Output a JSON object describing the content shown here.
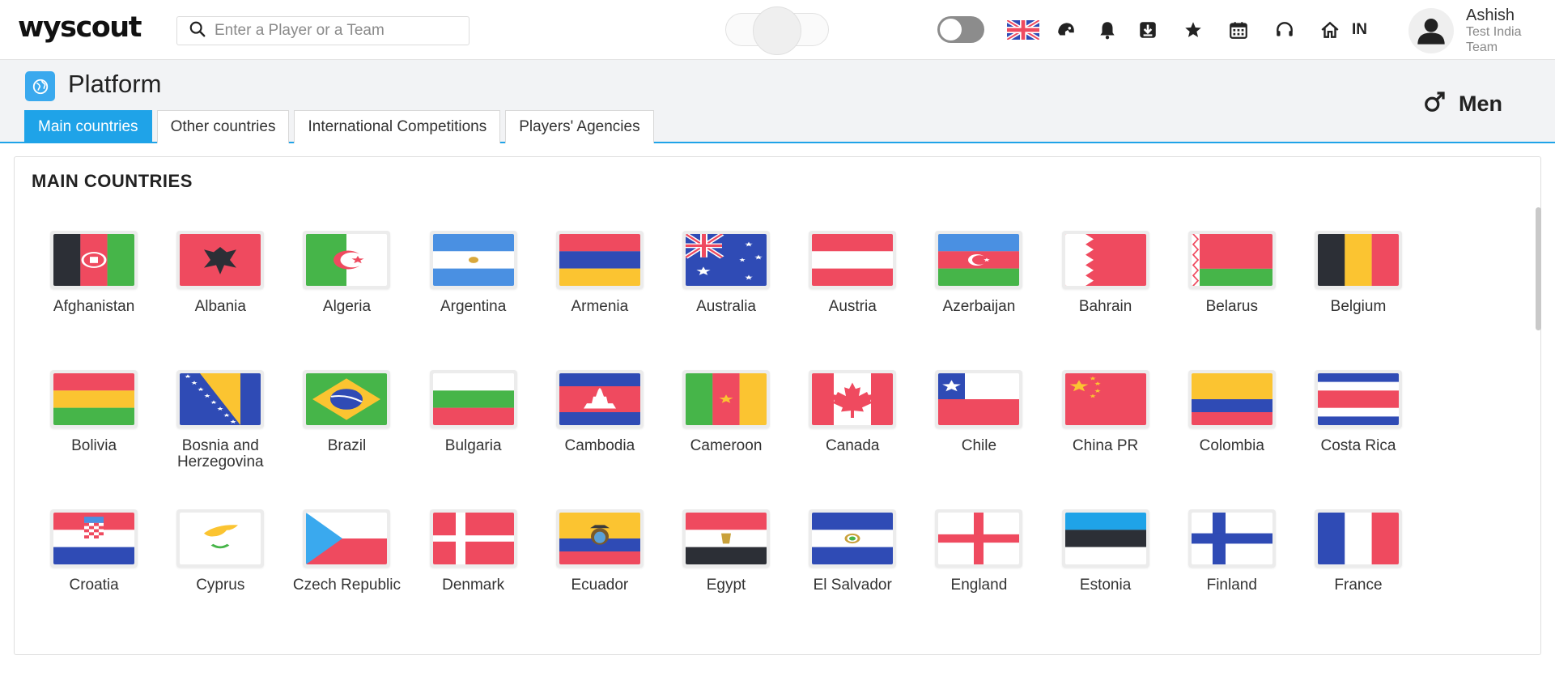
{
  "app": {
    "logo": "wyscout"
  },
  "search": {
    "placeholder": "Enter a Player or a Team"
  },
  "header": {
    "language_code": "IN",
    "user": {
      "name": "Ashish",
      "team": "Test India Team"
    },
    "icons": [
      "uk-flag-icon",
      "helmet-icon",
      "bell-icon",
      "download-icon",
      "star-icon",
      "calendar-icon",
      "headset-icon",
      "home-icon"
    ]
  },
  "page": {
    "title": "Platform",
    "gender": "Men",
    "tabs": [
      {
        "label": "Main countries",
        "active": true
      },
      {
        "label": "Other countries",
        "active": false
      },
      {
        "label": "International Competitions",
        "active": false
      },
      {
        "label": "Players' Agencies",
        "active": false
      }
    ]
  },
  "section": {
    "title": "MAIN COUNTRIES"
  },
  "countries": [
    {
      "name": "Afghanistan",
      "flag": "afghanistan"
    },
    {
      "name": "Albania",
      "flag": "albania"
    },
    {
      "name": "Algeria",
      "flag": "algeria"
    },
    {
      "name": "Argentina",
      "flag": "argentina"
    },
    {
      "name": "Armenia",
      "flag": "armenia"
    },
    {
      "name": "Australia",
      "flag": "australia"
    },
    {
      "name": "Austria",
      "flag": "austria"
    },
    {
      "name": "Azerbaijan",
      "flag": "azerbaijan"
    },
    {
      "name": "Bahrain",
      "flag": "bahrain"
    },
    {
      "name": "Belarus",
      "flag": "belarus"
    },
    {
      "name": "Belgium",
      "flag": "belgium"
    },
    {
      "name": "Bolivia",
      "flag": "bolivia"
    },
    {
      "name": "Bosnia and Herzegovina",
      "flag": "bosnia"
    },
    {
      "name": "Brazil",
      "flag": "brazil"
    },
    {
      "name": "Bulgaria",
      "flag": "bulgaria"
    },
    {
      "name": "Cambodia",
      "flag": "cambodia"
    },
    {
      "name": "Cameroon",
      "flag": "cameroon"
    },
    {
      "name": "Canada",
      "flag": "canada"
    },
    {
      "name": "Chile",
      "flag": "chile"
    },
    {
      "name": "China PR",
      "flag": "china"
    },
    {
      "name": "Colombia",
      "flag": "colombia"
    },
    {
      "name": "Costa Rica",
      "flag": "costarica"
    },
    {
      "name": "Croatia",
      "flag": "croatia"
    },
    {
      "name": "Cyprus",
      "flag": "cyprus"
    },
    {
      "name": "Czech Republic",
      "flag": "czech"
    },
    {
      "name": "Denmark",
      "flag": "denmark"
    },
    {
      "name": "Ecuador",
      "flag": "ecuador"
    },
    {
      "name": "Egypt",
      "flag": "egypt"
    },
    {
      "name": "El Salvador",
      "flag": "elsalvador"
    },
    {
      "name": "England",
      "flag": "england"
    },
    {
      "name": "Estonia",
      "flag": "estonia"
    },
    {
      "name": "Finland",
      "flag": "finland"
    },
    {
      "name": "France",
      "flag": "france"
    }
  ],
  "colors": {
    "accent": "#1fa3e8",
    "flag_red": "#ef4a5f",
    "flag_blue": "#2f4bb5",
    "flag_lightblue": "#4a90e2",
    "flag_yellow": "#fbc431",
    "flag_green": "#46b549",
    "flag_black": "#2c2f36"
  }
}
